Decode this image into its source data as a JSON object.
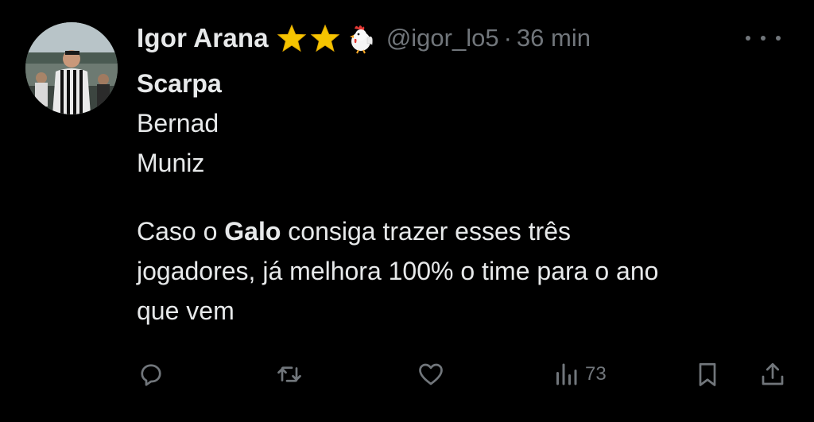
{
  "author": {
    "display_name": "Igor Arana",
    "handle": "@igor_lo5",
    "separator": "·",
    "time": "36 min",
    "badges": [
      "star-emoji",
      "star-emoji",
      "rooster-emoji"
    ]
  },
  "tweet": {
    "lines": [
      "Scarpa",
      "Bernad",
      "Muniz"
    ],
    "paragraph": {
      "line1_prefix": "Caso o ",
      "line1_bold": "Galo",
      "line1_suffix": " consiga trazer esses três",
      "line2": "jogadores, já melhora 100% o time para o ano",
      "line3": "que vem"
    }
  },
  "actions": {
    "views_count": "73"
  },
  "colors": {
    "background": "#000000",
    "text": "#e7e9ea",
    "muted": "#71767b"
  }
}
